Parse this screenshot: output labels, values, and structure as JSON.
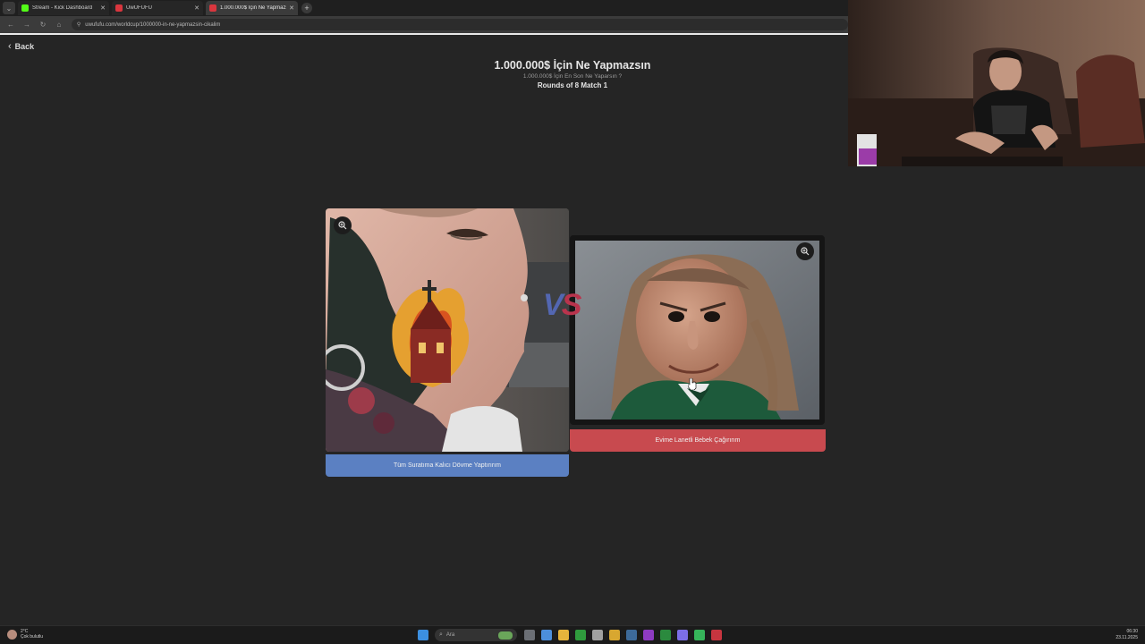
{
  "browser": {
    "tabs": [
      {
        "title": "Stream - Kick Dashboard",
        "favicon_color": "#53fc18",
        "active": false
      },
      {
        "title": "UwUFUFU",
        "favicon_color": "#d9363e",
        "active": false
      },
      {
        "title": "1.000.000$ İçin Ne Yapmazsın",
        "favicon_color": "#d9363e",
        "active": true
      }
    ],
    "url": "uwufufu.com/worldcup/1000000-in-ne-yapmazsin-cikalim"
  },
  "page": {
    "back_label": "Back",
    "title": "1.000.000$ İçin Ne Yapmazsın",
    "subtitle": "1.000.000$ İçin En Son Ne Yaparsın ?",
    "round": "Rounds of 8 Match 1",
    "vs_text": "VS",
    "left_choice": {
      "label": "Tüm Suratıma Kalıcı Dövme Yaptırırım",
      "color": "#5b80c2"
    },
    "right_choice": {
      "label": "Evime Lanetli Bebek Çağırırım",
      "color": "#c84a4f"
    }
  },
  "taskbar": {
    "weather_temp": "2°C",
    "weather_desc": "Çok bulutlu",
    "search_placeholder": "Ara",
    "time": "06:30",
    "date": "23.11.2025"
  }
}
